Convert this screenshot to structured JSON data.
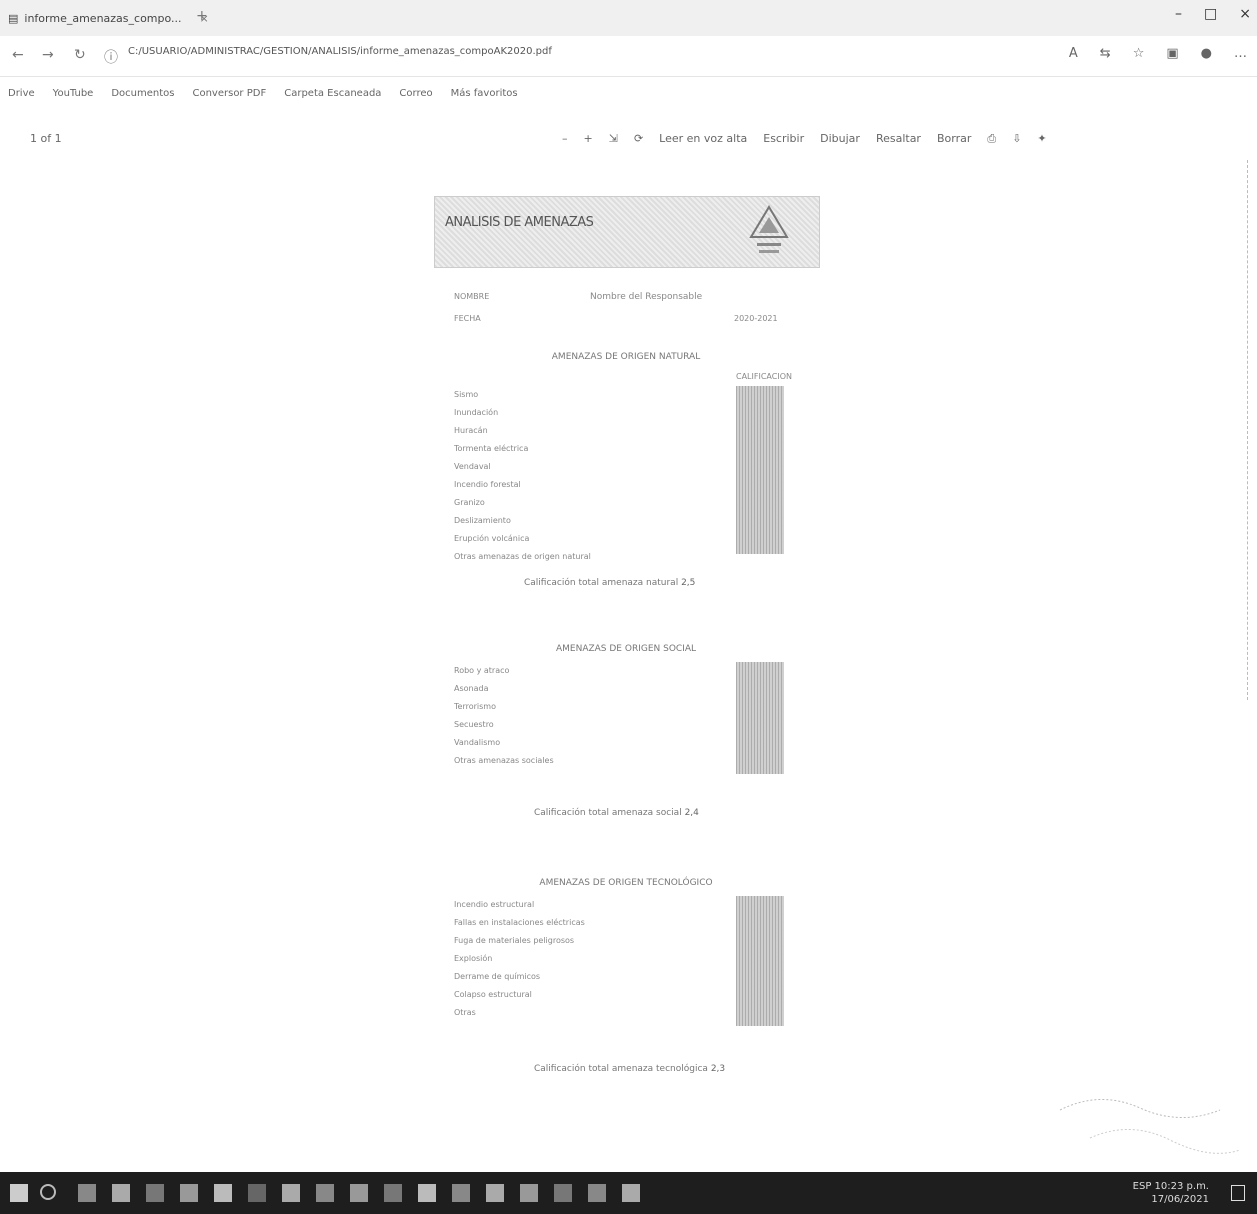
{
  "browser": {
    "tab_title": "informe_amenazas_compo...",
    "tab_close": "×",
    "new_tab": "+",
    "address": "C:/USUARIO/ADMINISTRAC/GESTION/ANALISIS/informe_amenazas_compoAK2020.pdf",
    "minimize": "–",
    "maximize": "□",
    "close": "×"
  },
  "bookmarks": [
    "Drive",
    "YouTube",
    "Documentos",
    "Conversor PDF",
    "Carpeta Escaneada",
    "Correo",
    "Más favoritos"
  ],
  "pdf_toolbar": {
    "page_indicator": "1 of 1",
    "zoom_out": "–",
    "zoom_in": "+",
    "tools": [
      "Leer en voz alta",
      "Escribir",
      "Dibujar",
      "Resaltar",
      "Borrar"
    ]
  },
  "document": {
    "title": "ANALISIS DE AMENAZAS",
    "meta_label_1": "NOMBRE",
    "meta_value_1": "Nombre del Responsable",
    "meta_label_2": "FECHA",
    "meta_value_2": "2020-2021",
    "sections": [
      {
        "title": "AMENAZAS DE ORIGEN NATURAL",
        "header_right": "CALIFICACION",
        "rows": [
          "Sismo",
          "Inundación",
          "Huracán",
          "Tormenta eléctrica",
          "Vendaval",
          "Incendio forestal",
          "Granizo",
          "Deslizamiento",
          "Erupción volcánica",
          "Otras amenazas de origen natural"
        ],
        "total_label": "Calificación total amenaza natural",
        "total_value": "2,5"
      },
      {
        "title": "AMENAZAS DE ORIGEN SOCIAL",
        "rows": [
          "Robo y atraco",
          "Asonada",
          "Terrorismo",
          "Secuestro",
          "Vandalismo",
          "Otras amenazas sociales"
        ],
        "total_label": "Calificación total amenaza social",
        "total_value": "2,4"
      },
      {
        "title": "AMENAZAS DE ORIGEN TECNOLÓGICO",
        "rows": [
          "Incendio estructural",
          "Fallas en instalaciones eléctricas",
          "Fuga de materiales peligrosos",
          "Explosión",
          "Derrame de químicos",
          "Colapso estructural",
          "Otras"
        ],
        "total_label": "Calificación total amenaza tecnológica",
        "total_value": "2,3"
      }
    ]
  },
  "taskbar": {
    "time": "10:23 p.m.",
    "date": "17/06/2021",
    "language": "ESP"
  }
}
